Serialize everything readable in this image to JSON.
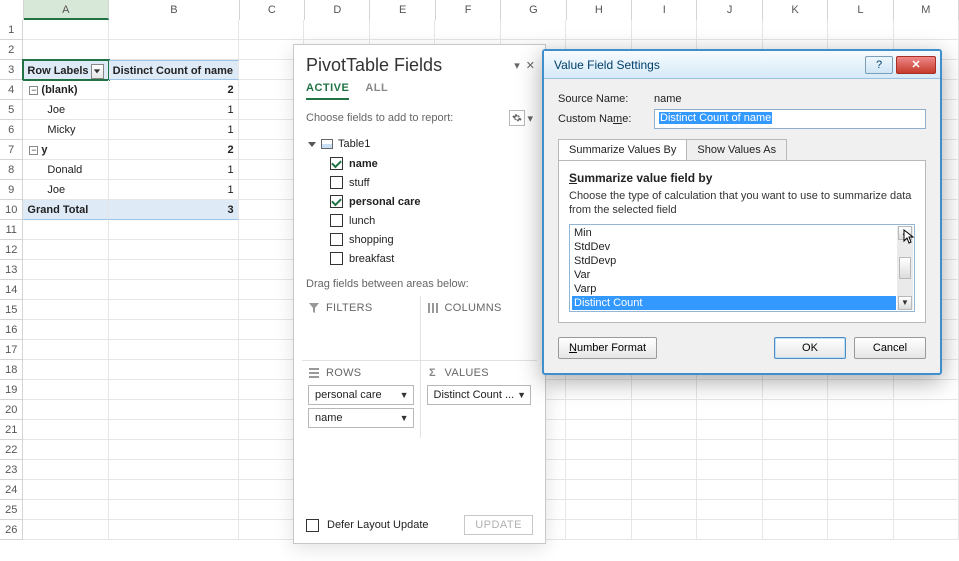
{
  "columns": [
    "A",
    "B",
    "C",
    "D",
    "E",
    "F",
    "G",
    "H",
    "I",
    "J",
    "K",
    "L",
    "M"
  ],
  "rowCount": 26,
  "activeCell": "A3",
  "pivotSheet": {
    "headerRow": 3,
    "headerA": "Row Labels",
    "headerB": "Distinct Count of name",
    "data": [
      {
        "r": 4,
        "indent": 0,
        "exp": "-",
        "label": "(blank)",
        "val": "2",
        "bold": true
      },
      {
        "r": 5,
        "indent": 1,
        "label": "Joe",
        "val": "1"
      },
      {
        "r": 6,
        "indent": 1,
        "label": "Micky",
        "val": "1"
      },
      {
        "r": 7,
        "indent": 0,
        "exp": "-",
        "label": "y",
        "val": "2",
        "bold": true
      },
      {
        "r": 8,
        "indent": 1,
        "label": "Donald",
        "val": "1"
      },
      {
        "r": 9,
        "indent": 1,
        "label": "Joe",
        "val": "1"
      },
      {
        "r": 10,
        "label": "Grand Total",
        "val": "3",
        "grand": true
      }
    ]
  },
  "pane": {
    "title": "PivotTable Fields",
    "tabs": {
      "active": "ACTIVE",
      "all": "ALL"
    },
    "hint": "Choose fields to add to report:",
    "table": "Table1",
    "fields": [
      {
        "label": "name",
        "checked": true,
        "bold": true
      },
      {
        "label": "stuff",
        "checked": false
      },
      {
        "label": "personal care",
        "checked": true,
        "bold": true
      },
      {
        "label": "lunch",
        "checked": false
      },
      {
        "label": "shopping",
        "checked": false
      },
      {
        "label": "breakfast",
        "checked": false
      }
    ],
    "dragHint": "Drag fields between areas below:",
    "areas": {
      "filters": "FILTERS",
      "columns": "COLUMNS",
      "rows": "ROWS",
      "values": "VALUES"
    },
    "rowsPills": [
      "personal care",
      "name"
    ],
    "valuesPills": [
      "Distinct Count ..."
    ],
    "deferLabel": "Defer Layout Update",
    "updateLabel": "UPDATE"
  },
  "dialog": {
    "title": "Value Field Settings",
    "sourceLabel": "Source Name:",
    "sourceValue": "name",
    "customLabel": "Custom Name:",
    "customValue": "Distinct Count of name",
    "tabA": "Summarize Values By",
    "tabB": "Show Values As",
    "groupTitle": "Summarize value field by",
    "groupDesc": "Choose the type of calculation that you want to use to summarize data from the selected field",
    "listItems": [
      "Min",
      "StdDev",
      "StdDevp",
      "Var",
      "Varp",
      "Distinct Count"
    ],
    "listSelected": "Distinct Count",
    "numberFormat": "Number Format",
    "ok": "OK",
    "cancel": "Cancel"
  }
}
